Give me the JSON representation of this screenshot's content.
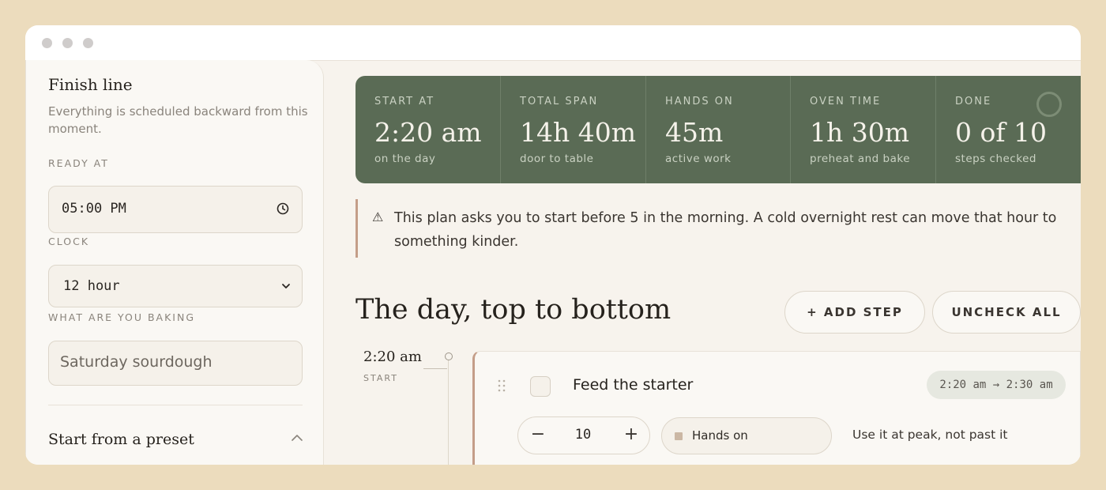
{
  "sidebar": {
    "title": "Finish line",
    "subtitle": "Everything is scheduled backward from this moment.",
    "ready_label": "READY AT",
    "ready_value": "05:00 PM",
    "clock_label": "CLOCK",
    "clock_value": "12 hour",
    "baking_label": "WHAT ARE YOU BAKING",
    "baking_value": "Saturday sourdough",
    "preset_label": "Start from a preset"
  },
  "stats": [
    {
      "label": "START AT",
      "value": "2:20 am",
      "sub": "on the day"
    },
    {
      "label": "TOTAL SPAN",
      "value": "14h 40m",
      "sub": "door to table"
    },
    {
      "label": "HANDS ON",
      "value": "45m",
      "sub": "active work"
    },
    {
      "label": "OVEN TIME",
      "value": "1h 30m",
      "sub": "preheat and bake"
    },
    {
      "label": "DONE",
      "value": "0 of 10",
      "sub": "steps checked"
    }
  ],
  "warning": {
    "icon": "warning-icon",
    "text": "This plan asks you to start before 5 in the morning. A cold overnight rest can move that hour to something kinder."
  },
  "schedule": {
    "heading": "The day, top to bottom",
    "add_step": "+  ADD STEP",
    "uncheck_all": "UNCHECK ALL"
  },
  "timeline": {
    "time": "2:20 am",
    "marker": "START"
  },
  "steps": [
    {
      "name": "Feed the starter",
      "time_range": "2:20 am → 2:30 am",
      "minus": "−",
      "quantity": "10",
      "plus": "+",
      "type": "Hands on",
      "note": "Use it at peak, not past it"
    }
  ],
  "colors": {
    "background": "#ecdcbd",
    "stats_panel": "#5a6b55",
    "accent": "#c49d88"
  }
}
